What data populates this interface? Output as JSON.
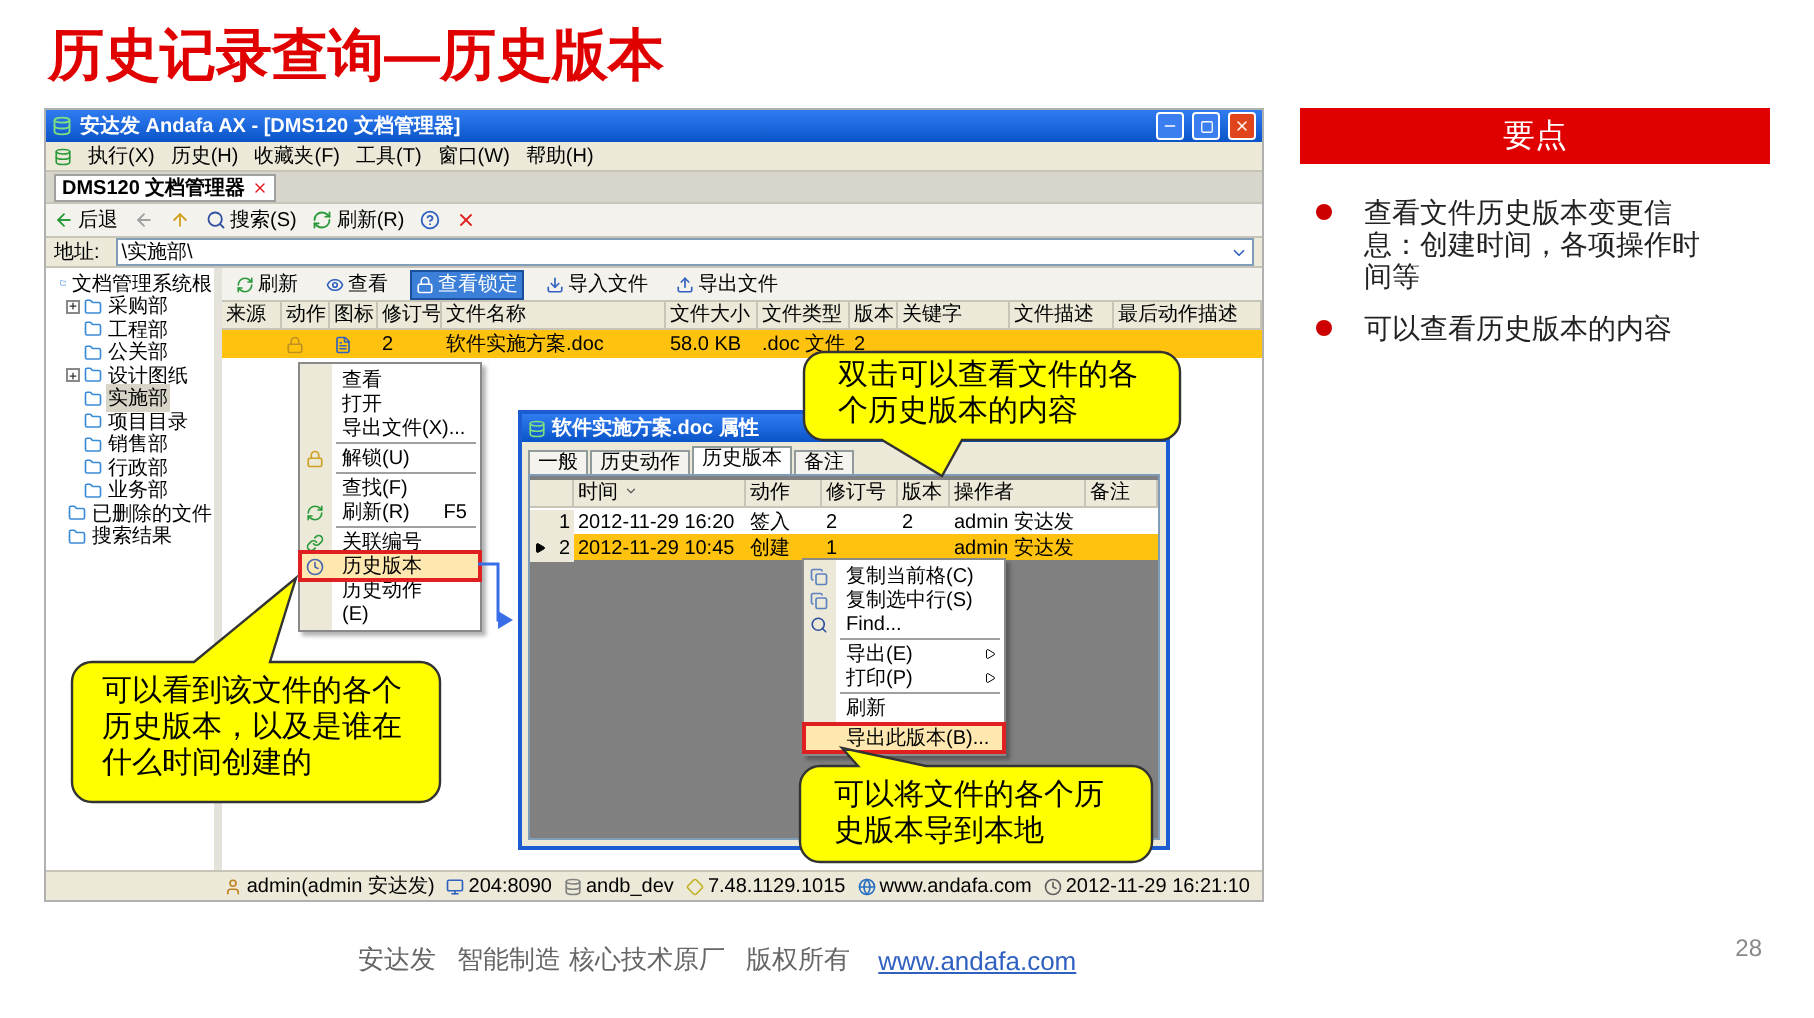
{
  "slide_title": "历史记录查询—历史版本",
  "app": {
    "title": "安达发 Andafa AX - [DMS120 文档管理器]",
    "menu": [
      "执行(X)",
      "历史(H)",
      "收藏夹(F)",
      "工具(T)",
      "窗口(W)",
      "帮助(H)"
    ],
    "doc_tab": "DMS120 文档管理器",
    "toolbar": [
      "后退",
      "搜索(S)",
      "刷新(R)"
    ],
    "address": {
      "label": "地址:",
      "value": "\\实施部\\"
    },
    "tree": [
      {
        "label": "文档管理系统根",
        "selected": false,
        "collapsed": false,
        "children": [
          {
            "label": "采购部",
            "selected": false,
            "collapsed": true
          },
          {
            "label": "工程部",
            "selected": false,
            "collapsed": false
          },
          {
            "label": "公关部",
            "selected": false,
            "collapsed": false
          },
          {
            "label": "设计图纸",
            "selected": false,
            "collapsed": true
          },
          {
            "label": "实施部",
            "selected": true,
            "collapsed": false
          },
          {
            "label": "项目目录",
            "selected": false,
            "collapsed": false
          },
          {
            "label": "销售部",
            "selected": false,
            "collapsed": false
          },
          {
            "label": "行政部",
            "selected": false,
            "collapsed": false
          },
          {
            "label": "业务部",
            "selected": false,
            "collapsed": false
          }
        ]
      },
      {
        "label": "已删除的文件",
        "selected": false,
        "collapsed": false
      },
      {
        "label": "搜索结果",
        "selected": false,
        "collapsed": false
      }
    ],
    "list_toolbar": [
      {
        "label": "刷新",
        "selected": false
      },
      {
        "label": "查看",
        "selected": false
      },
      {
        "label": "查看锁定",
        "selected": true
      },
      {
        "label": "导入文件",
        "selected": false
      },
      {
        "label": "导出文件",
        "selected": false
      }
    ],
    "columns": [
      "来源",
      "动作",
      "图标",
      "修订号",
      "文件名称",
      "文件大小",
      "文件类型",
      "版本",
      "关键字",
      "文件描述",
      "最后动作描述"
    ],
    "rows": [
      {
        "selected": true,
        "revision": "2",
        "file_name": "软件实施方案.doc",
        "file_size": "58.0 KB",
        "file_type": ".doc 文件",
        "version": "2"
      }
    ],
    "context_menu": [
      [
        {
          "label": "查看",
          "selected": false
        },
        {
          "label": "打开",
          "selected": false
        },
        {
          "label": "导出文件(X)...",
          "selected": false
        }
      ],
      [
        {
          "label": "解锁(U)",
          "selected": false
        }
      ],
      [
        {
          "label": "查找(F)",
          "selected": false
        },
        {
          "label": "刷新(R)",
          "shortcut": "F5",
          "selected": false
        }
      ],
      [
        {
          "label": "关联编号",
          "selected": false
        },
        {
          "label": "历史版本",
          "selected": true
        },
        {
          "label": "历史动作",
          "selected": false
        },
        {
          "label": "(E)",
          "selected": false
        }
      ]
    ],
    "properties": {
      "title": "软件实施方案.doc 属性",
      "tabs": [
        {
          "label": "一般",
          "selected": false
        },
        {
          "label": "历史动作",
          "selected": false
        },
        {
          "label": "历史版本",
          "selected": true
        },
        {
          "label": "备注",
          "selected": false
        }
      ],
      "columns": [
        "时间",
        "动作",
        "修订号",
        "版本",
        "操作者",
        "备注"
      ],
      "rows": [
        {
          "number": "1",
          "time": "2012-11-29 16:20",
          "action": "签入",
          "revision": "2",
          "version": "2",
          "operator": "admin 安达发",
          "selected": false
        },
        {
          "number": "2",
          "time": "2012-11-29 10:45",
          "action": "创建",
          "revision": "1",
          "operator": "admin 安达发",
          "selected": true
        }
      ],
      "context_menu": [
        [
          {
            "label": "复制当前格(C)",
            "submenu": false,
            "selected": false
          },
          {
            "label": "复制选中行(S)",
            "submenu": false,
            "selected": false
          },
          {
            "label": "Find...",
            "submenu": false,
            "selected": false
          }
        ],
        [
          {
            "label": "导出(E)",
            "submenu": true,
            "selected": false
          },
          {
            "label": "打印(P)",
            "submenu": true,
            "selected": false
          }
        ],
        [
          {
            "label": "刷新",
            "submenu": false,
            "selected": false
          }
        ],
        [
          {
            "label": "导出此版本(B)...",
            "submenu": false,
            "selected": true
          }
        ]
      ]
    },
    "status_bar": [
      "admin(admin 安达发)",
      "204:8090",
      "andb_dev",
      "7.48.1129.1015",
      "www.andafa.com",
      "2012-11-29 16:21:10"
    ]
  },
  "callouts": [
    "双击可以查看文件的各个历史版本的内容",
    "可以看到该文件的各个历史版本，以及是谁在什么时间创建的",
    "可以将文件的各个历史版本导到本地"
  ],
  "key_points": {
    "heading": "要点",
    "items": [
      "查看文件历史版本变更信息：创建时间，各项操作时间等",
      "可以查看历史版本的内容"
    ]
  },
  "footer": {
    "text": "安达发   智能制造 核心技术原厂   版权所有",
    "link": "www.andafa.com",
    "page": "28"
  }
}
